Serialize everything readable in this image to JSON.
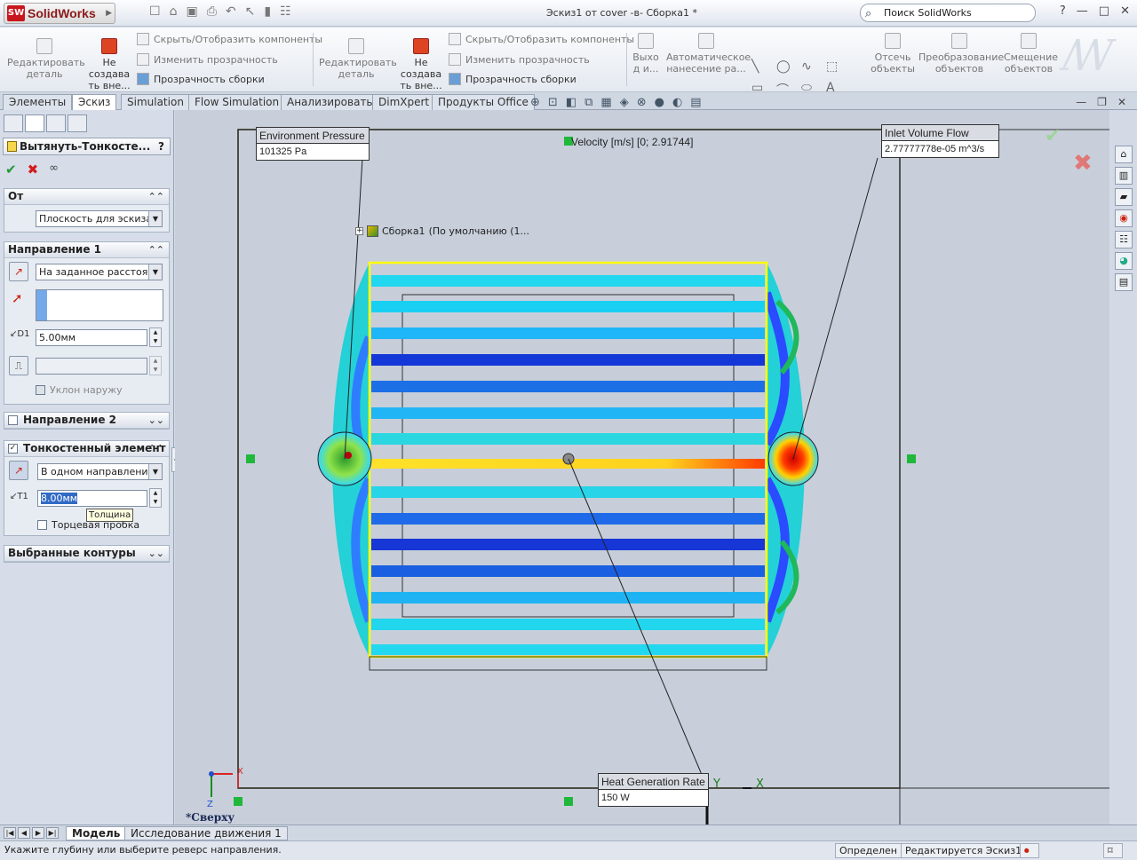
{
  "app": {
    "logo_text": "SolidWorks",
    "logo_badge": "SW",
    "window_title": "Эскиз1 от cover -в- Сборка1 *",
    "search_placeholder": "Поиск SolidWorks"
  },
  "ribbon": {
    "group1": {
      "edit_part": "Редактировать деталь",
      "no_external": "Не создава ть вне...",
      "show_hide": "Скрыть/Отобразить компоненты",
      "change_transparency": "Изменить прозрачность",
      "assembly_transparency": "Прозрачность сборки"
    },
    "group2": {
      "edit_part": "Редактировать деталь",
      "no_external": "Не создава ть вне...",
      "show_hide": "Скрыть/Отобразить компоненты",
      "change_transparency": "Изменить прозрачность",
      "assembly_transparency": "Прозрачность сборки"
    },
    "exit": "Выхо д и...",
    "auto_dim": "Автоматическое нанесение ра...",
    "trim": "Отсечь объекты",
    "convert": "Преобразование объектов",
    "offset": "Смещение объектов"
  },
  "tabs": [
    "Элементы",
    "Эскиз",
    "Simulation",
    "Flow Simulation",
    "Анализировать",
    "DimXpert",
    "Продукты Office"
  ],
  "active_tab": "Эскиз",
  "feature": {
    "title": "Вытянуть-Тонкосте...",
    "help": "?",
    "from": {
      "header": "От",
      "value": "Плоскость для эскиза"
    },
    "dir1": {
      "header": "Направление 1",
      "type": "На заданное расстояни",
      "depth": "5.00мм",
      "draft_outward": "Уклон наружу"
    },
    "dir2": {
      "header": "Направление 2"
    },
    "thin": {
      "header": "Тонкостенный элемент",
      "type": "В одном направлении",
      "thickness": "8.00мм",
      "cap_ends": "Торцевая пробка",
      "tooltip": "Толщина"
    },
    "contours": {
      "header": "Выбранные контуры"
    }
  },
  "tree": {
    "root": "Сборка1",
    "config": "(По умолчанию (1..."
  },
  "callouts": {
    "env_pressure": {
      "title": "Environment Pressure",
      "value": "101325 Pa"
    },
    "velocity": "Velocity [m/s] [0; 2.91744]",
    "inlet_flow": {
      "title": "Inlet Volume Flow",
      "value": "2.77777778e-05 m^3/s"
    },
    "heat_gen": {
      "title": "Heat Generation Rate",
      "value": "150 W"
    }
  },
  "view": {
    "orientation": "*Сверху",
    "axis_x": "X",
    "axis_y": "Y",
    "axis_z": "Z"
  },
  "bottom_tabs": [
    "Модель",
    "Исследование движения 1"
  ],
  "status": {
    "message": "Укажите глубину или выберите реверс направления.",
    "defined": "Определен",
    "editing": "Редактируется Эскиз1"
  },
  "colors": {
    "accent": "#2e5c9a",
    "highlight_yellow": "#ffff00",
    "ok_green": "#1f9a2e",
    "cancel_red": "#d21c1c"
  }
}
